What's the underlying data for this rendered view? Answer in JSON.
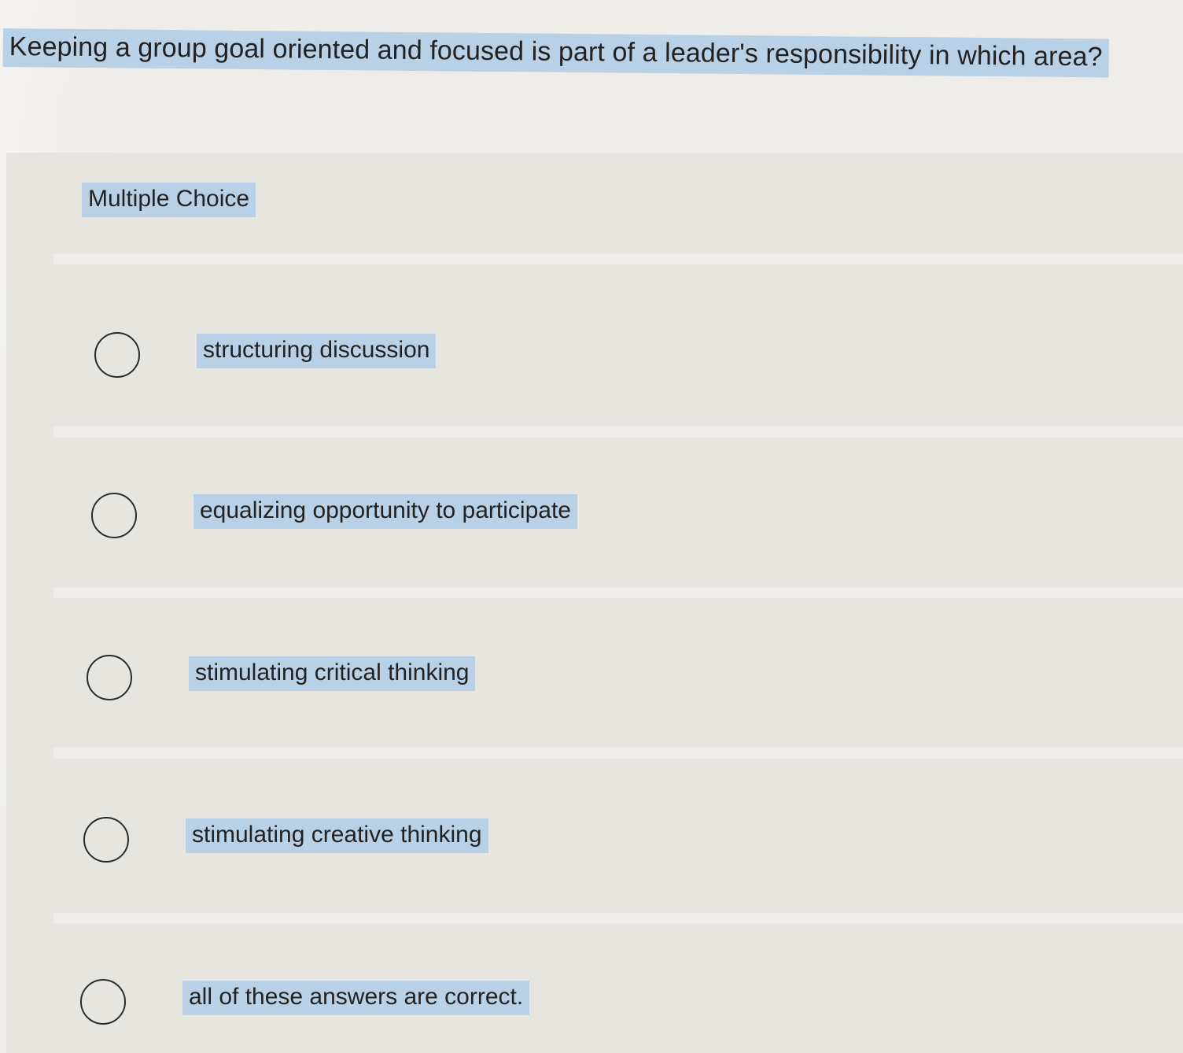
{
  "question": {
    "text": "Keeping a group goal oriented and focused is part of a leader's responsibility in which area?"
  },
  "question_type": "Multiple Choice",
  "options": [
    {
      "label": "structuring discussion",
      "selected": false
    },
    {
      "label": "equalizing opportunity to participate",
      "selected": false
    },
    {
      "label": "stimulating critical thinking",
      "selected": false
    },
    {
      "label": "stimulating creative thinking",
      "selected": false
    },
    {
      "label": "all of these answers are correct.",
      "selected": false
    }
  ],
  "colors": {
    "text_selection_highlight": "#b9d1e6",
    "page_background": "#eceae6",
    "radio_border": "#2b2b2b"
  },
  "icons": {
    "radio": "radio-unchecked-icon"
  }
}
